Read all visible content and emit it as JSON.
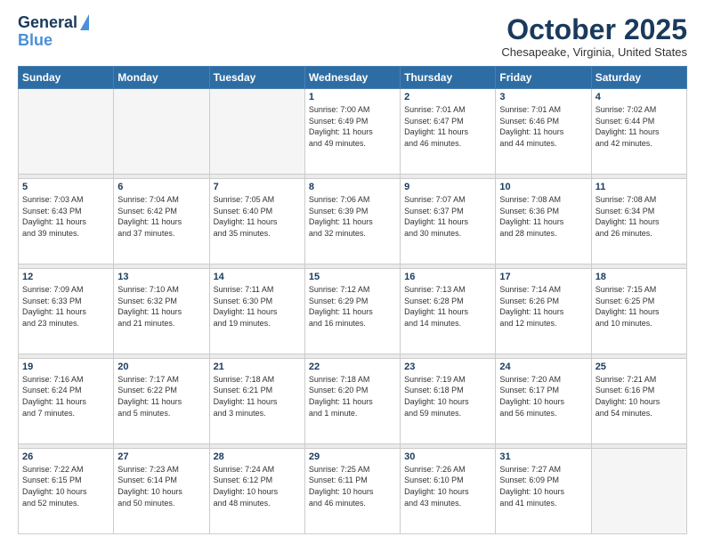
{
  "header": {
    "logo_line1": "General",
    "logo_line2": "Blue",
    "month": "October 2025",
    "location": "Chesapeake, Virginia, United States"
  },
  "weekdays": [
    "Sunday",
    "Monday",
    "Tuesday",
    "Wednesday",
    "Thursday",
    "Friday",
    "Saturday"
  ],
  "weeks": [
    [
      {
        "day": "",
        "info": ""
      },
      {
        "day": "",
        "info": ""
      },
      {
        "day": "",
        "info": ""
      },
      {
        "day": "1",
        "info": "Sunrise: 7:00 AM\nSunset: 6:49 PM\nDaylight: 11 hours\nand 49 minutes."
      },
      {
        "day": "2",
        "info": "Sunrise: 7:01 AM\nSunset: 6:47 PM\nDaylight: 11 hours\nand 46 minutes."
      },
      {
        "day": "3",
        "info": "Sunrise: 7:01 AM\nSunset: 6:46 PM\nDaylight: 11 hours\nand 44 minutes."
      },
      {
        "day": "4",
        "info": "Sunrise: 7:02 AM\nSunset: 6:44 PM\nDaylight: 11 hours\nand 42 minutes."
      }
    ],
    [
      {
        "day": "5",
        "info": "Sunrise: 7:03 AM\nSunset: 6:43 PM\nDaylight: 11 hours\nand 39 minutes."
      },
      {
        "day": "6",
        "info": "Sunrise: 7:04 AM\nSunset: 6:42 PM\nDaylight: 11 hours\nand 37 minutes."
      },
      {
        "day": "7",
        "info": "Sunrise: 7:05 AM\nSunset: 6:40 PM\nDaylight: 11 hours\nand 35 minutes."
      },
      {
        "day": "8",
        "info": "Sunrise: 7:06 AM\nSunset: 6:39 PM\nDaylight: 11 hours\nand 32 minutes."
      },
      {
        "day": "9",
        "info": "Sunrise: 7:07 AM\nSunset: 6:37 PM\nDaylight: 11 hours\nand 30 minutes."
      },
      {
        "day": "10",
        "info": "Sunrise: 7:08 AM\nSunset: 6:36 PM\nDaylight: 11 hours\nand 28 minutes."
      },
      {
        "day": "11",
        "info": "Sunrise: 7:08 AM\nSunset: 6:34 PM\nDaylight: 11 hours\nand 26 minutes."
      }
    ],
    [
      {
        "day": "12",
        "info": "Sunrise: 7:09 AM\nSunset: 6:33 PM\nDaylight: 11 hours\nand 23 minutes."
      },
      {
        "day": "13",
        "info": "Sunrise: 7:10 AM\nSunset: 6:32 PM\nDaylight: 11 hours\nand 21 minutes."
      },
      {
        "day": "14",
        "info": "Sunrise: 7:11 AM\nSunset: 6:30 PM\nDaylight: 11 hours\nand 19 minutes."
      },
      {
        "day": "15",
        "info": "Sunrise: 7:12 AM\nSunset: 6:29 PM\nDaylight: 11 hours\nand 16 minutes."
      },
      {
        "day": "16",
        "info": "Sunrise: 7:13 AM\nSunset: 6:28 PM\nDaylight: 11 hours\nand 14 minutes."
      },
      {
        "day": "17",
        "info": "Sunrise: 7:14 AM\nSunset: 6:26 PM\nDaylight: 11 hours\nand 12 minutes."
      },
      {
        "day": "18",
        "info": "Sunrise: 7:15 AM\nSunset: 6:25 PM\nDaylight: 11 hours\nand 10 minutes."
      }
    ],
    [
      {
        "day": "19",
        "info": "Sunrise: 7:16 AM\nSunset: 6:24 PM\nDaylight: 11 hours\nand 7 minutes."
      },
      {
        "day": "20",
        "info": "Sunrise: 7:17 AM\nSunset: 6:22 PM\nDaylight: 11 hours\nand 5 minutes."
      },
      {
        "day": "21",
        "info": "Sunrise: 7:18 AM\nSunset: 6:21 PM\nDaylight: 11 hours\nand 3 minutes."
      },
      {
        "day": "22",
        "info": "Sunrise: 7:18 AM\nSunset: 6:20 PM\nDaylight: 11 hours\nand 1 minute."
      },
      {
        "day": "23",
        "info": "Sunrise: 7:19 AM\nSunset: 6:18 PM\nDaylight: 10 hours\nand 59 minutes."
      },
      {
        "day": "24",
        "info": "Sunrise: 7:20 AM\nSunset: 6:17 PM\nDaylight: 10 hours\nand 56 minutes."
      },
      {
        "day": "25",
        "info": "Sunrise: 7:21 AM\nSunset: 6:16 PM\nDaylight: 10 hours\nand 54 minutes."
      }
    ],
    [
      {
        "day": "26",
        "info": "Sunrise: 7:22 AM\nSunset: 6:15 PM\nDaylight: 10 hours\nand 52 minutes."
      },
      {
        "day": "27",
        "info": "Sunrise: 7:23 AM\nSunset: 6:14 PM\nDaylight: 10 hours\nand 50 minutes."
      },
      {
        "day": "28",
        "info": "Sunrise: 7:24 AM\nSunset: 6:12 PM\nDaylight: 10 hours\nand 48 minutes."
      },
      {
        "day": "29",
        "info": "Sunrise: 7:25 AM\nSunset: 6:11 PM\nDaylight: 10 hours\nand 46 minutes."
      },
      {
        "day": "30",
        "info": "Sunrise: 7:26 AM\nSunset: 6:10 PM\nDaylight: 10 hours\nand 43 minutes."
      },
      {
        "day": "31",
        "info": "Sunrise: 7:27 AM\nSunset: 6:09 PM\nDaylight: 10 hours\nand 41 minutes."
      },
      {
        "day": "",
        "info": ""
      }
    ]
  ]
}
